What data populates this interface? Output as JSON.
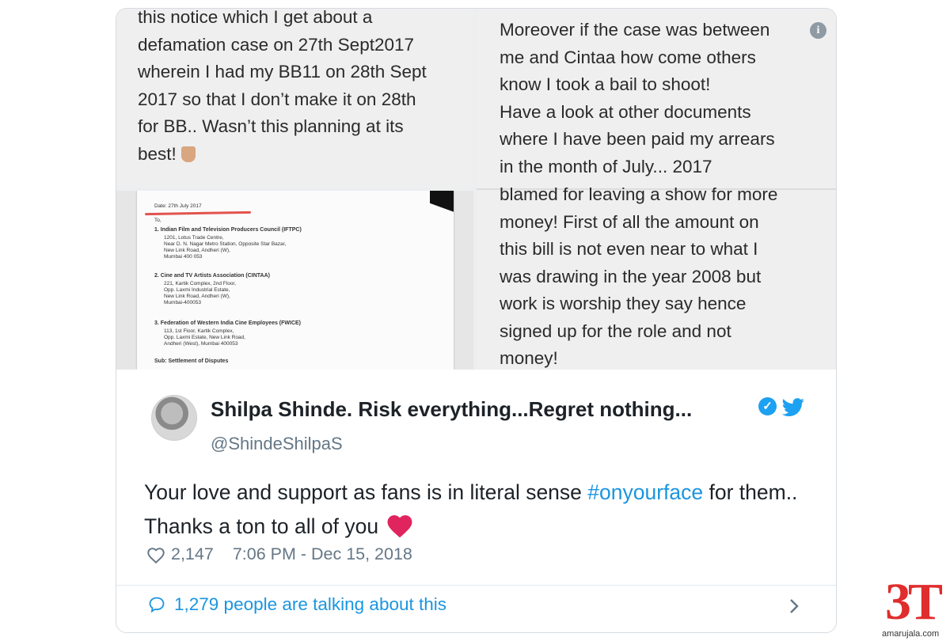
{
  "media": {
    "top_left_lines": [
      "this notice which I get about a",
      "defamation case on 27th Sept2017",
      "wherein I had my BB11 on 28th Sept",
      "2017 so that I don’t make it on 28th",
      "for BB.. Wasn’t this planning at its",
      "best!"
    ],
    "right_top_lines": [
      "Moreover if the case was between",
      "me and Cintaa how come others",
      "know I took a bail to shoot!",
      "Have a look at other documents",
      "where I have been paid my arrears",
      "in the month of July... 2017"
    ],
    "right_bottom_lines": [
      "blamed for leaving a show for more",
      "money! First of all the amount on",
      "this bill is not even near to what I",
      "was drawing in the year 2008 but",
      "work is worship they say hence",
      "signed up for the role and not",
      "money!"
    ],
    "info_icon_glyph": "i",
    "document": {
      "date": "Date: 27th July 2017",
      "to": "To,",
      "items": [
        "1.  Indian Film and Television Producers Council (IFTPC)",
        "1201, Lotus Trade Centre,",
        "Near D. N. Nagar Metro Station, Opposite Star Bazar,",
        "New Link Road, Andheri (W),",
        "Mumbai 400 053",
        "2.  Cine and TV Artists Association (CINTAA)",
        "221, Kartik Complex, 2nd Floor,",
        "Opp. Laxmi Industrial Estate,",
        "New Link Road, Andheri (W),",
        "Mumbai-400053",
        "3.  Federation of Western India Cine Employees (FWICE)",
        "113, 1st Floor, Kartik Complex,",
        "Opp. Laxmi Estate, New Link Road,",
        "Andheri (West), Mumbai 400053",
        "Sub: Settlement of Disputes"
      ]
    }
  },
  "tweet": {
    "author_name": "Shilpa Shinde. Risk everything...Regret nothing...",
    "handle": "@ShindeShilpaS",
    "verified_glyph": "✓",
    "text_before_hashtag": "Your love and support as fans is in literal sense ",
    "hashtag": "#onyourface",
    "text_after_hashtag": " for them.. Thanks a ton to all of you",
    "likes": "2,147",
    "timestamp": "7:06 PM - Dec 15, 2018",
    "talking": "1,279 people are talking about this"
  },
  "watermark": {
    "mark": "3T",
    "site": "amarujala.com"
  },
  "colors": {
    "link_blue": "#1b95e0",
    "verified_blue": "#1da1f2",
    "heart_red": "#e0245e",
    "brand_red": "#e02d2d"
  }
}
